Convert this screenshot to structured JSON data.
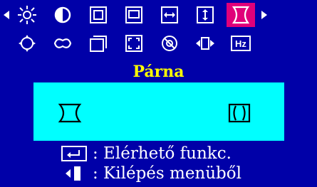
{
  "menu": {
    "icons": [
      {
        "name": "brightness-icon"
      },
      {
        "name": "contrast-icon"
      },
      {
        "name": "h-size-icon"
      },
      {
        "name": "v-size-icon"
      },
      {
        "name": "h-position-icon"
      },
      {
        "name": "v-position-icon"
      },
      {
        "name": "pincushion-icon",
        "selected": true
      },
      {
        "name": "position-icon"
      },
      {
        "name": "color-icon"
      },
      {
        "name": "recall-icon"
      },
      {
        "name": "zoom-icon"
      },
      {
        "name": "degauss-icon"
      },
      {
        "name": "exit-tab-icon"
      },
      {
        "name": "frequency-icon",
        "label": "Hz"
      }
    ],
    "selected_color": "#e0007a",
    "title_color": "#ffff00",
    "background": "#0000a8",
    "panel_color": "#00ffff"
  },
  "page": {
    "title": "Párna"
  },
  "panel": {
    "option_left": "pincushion-inward-icon",
    "option_right": "pincushion-outward-icon"
  },
  "footer": {
    "enter_hint": ": Elérhető funkc.",
    "exit_hint": ": Kilépés menüből"
  }
}
